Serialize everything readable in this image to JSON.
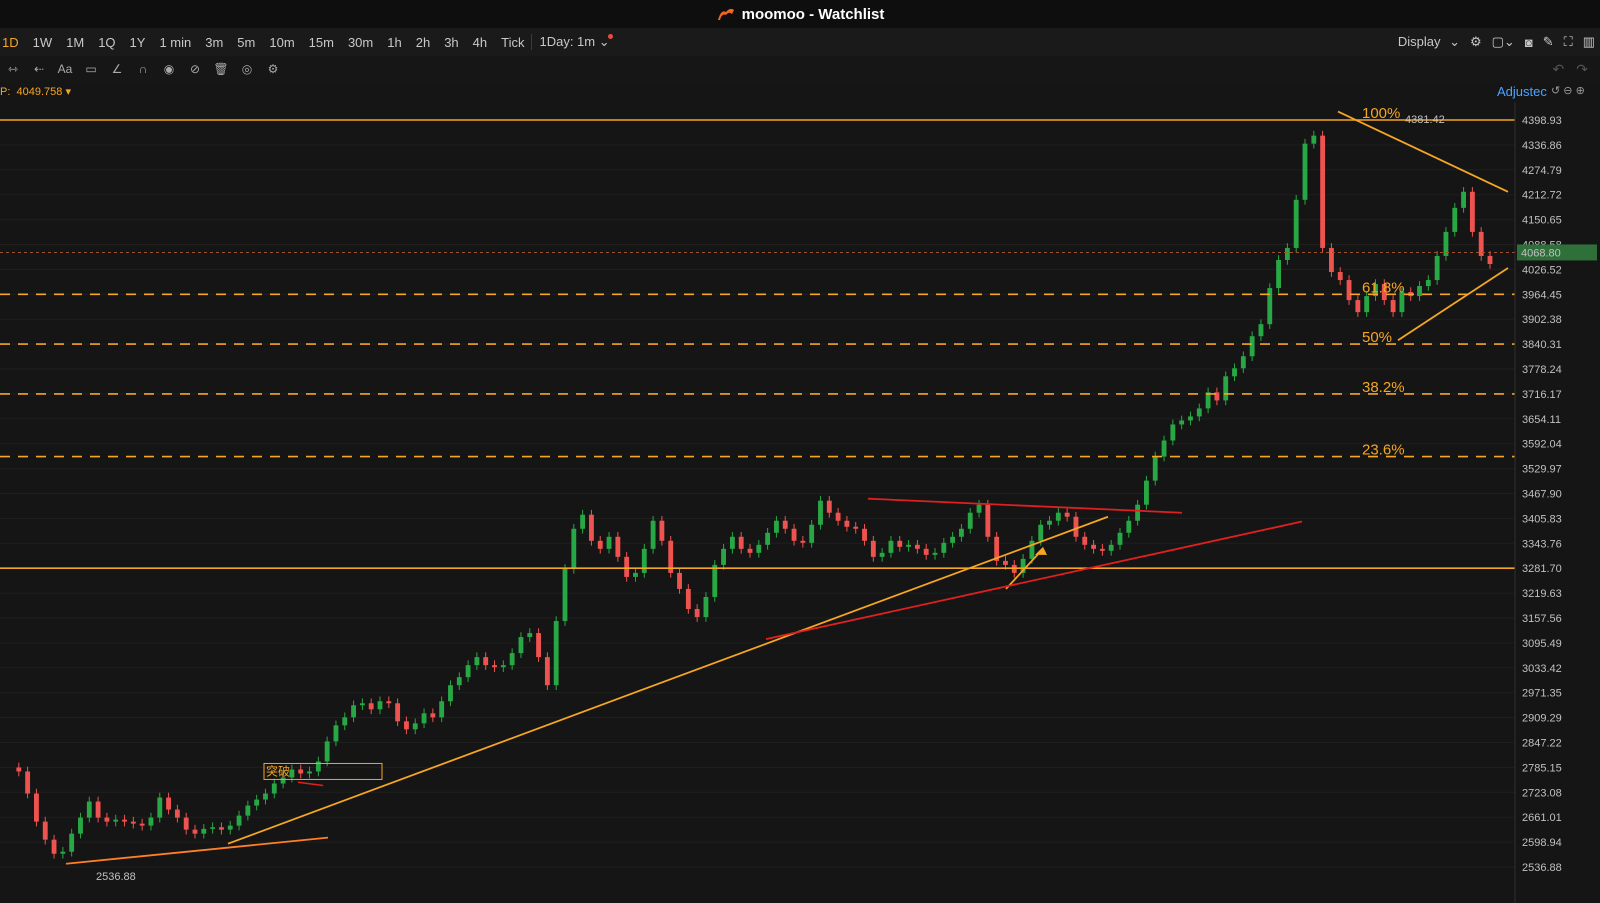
{
  "app": {
    "title": "moomoo - Watchlist"
  },
  "toolbar": {
    "timeframes": [
      "1D",
      "1W",
      "1M",
      "1Q",
      "1Y",
      "1 min",
      "3m",
      "5m",
      "10m",
      "15m",
      "30m",
      "1h",
      "2h",
      "3h",
      "4h",
      "Tick"
    ],
    "active": "1D",
    "interval_label": "1Day: 1m",
    "display_label": "Display"
  },
  "info": {
    "price_prefix": "P:",
    "price": "4049.758",
    "adjusted_label": "Adjustec"
  },
  "chart_data": {
    "type": "candlestick",
    "y_axis_ticks": [
      "4398.93",
      "4336.86",
      "4274.79",
      "4212.72",
      "4150.65",
      "4088.58",
      "4026.52",
      "3964.45",
      "3902.38",
      "3840.31",
      "3778.24",
      "3716.17",
      "3654.11",
      "3592.04",
      "3529.97",
      "3467.90",
      "3405.83",
      "3343.76",
      "3281.70",
      "3219.63",
      "3157.56",
      "3095.49",
      "3033.42",
      "2971.35",
      "2909.29",
      "2847.22",
      "2785.15",
      "2723.08",
      "2661.01",
      "2598.94",
      "2536.88"
    ],
    "ylim": [
      2536.88,
      4398.93
    ],
    "current_price_label": "4068.80",
    "high_label": "4381.42",
    "low_label": "2536.88",
    "fib_levels": [
      {
        "label": "100%",
        "value": 4398.93
      },
      {
        "label": "61.8%",
        "value": 3964.45
      },
      {
        "label": "50%",
        "value": 3840.31
      },
      {
        "label": "38.2%",
        "value": 3716.17
      },
      {
        "label": "23.6%",
        "value": 3560
      }
    ],
    "support_level": 3281.7,
    "annotation": "突破",
    "colors": {
      "up": "#28a745",
      "down": "#ef5350",
      "fib": "#f5a623",
      "trend_red": "#e02020"
    },
    "series": [
      2785,
      2775,
      2720,
      2650,
      2605,
      2570,
      2575,
      2620,
      2660,
      2700,
      2660,
      2650,
      2655,
      2650,
      2645,
      2640,
      2660,
      2710,
      2680,
      2660,
      2630,
      2620,
      2632,
      2636,
      2630,
      2640,
      2665,
      2690,
      2705,
      2720,
      2745,
      2760,
      2780,
      2770,
      2775,
      2800,
      2850,
      2890,
      2910,
      2940,
      2945,
      2930,
      2950,
      2945,
      2900,
      2880,
      2895,
      2920,
      2910,
      2950,
      2990,
      3010,
      3040,
      3060,
      3040,
      3035,
      3040,
      3070,
      3110,
      3120,
      3060,
      2990,
      3150,
      3280,
      3380,
      3415,
      3350,
      3330,
      3360,
      3310,
      3260,
      3270,
      3330,
      3400,
      3350,
      3270,
      3230,
      3180,
      3160,
      3210,
      3290,
      3330,
      3360,
      3330,
      3320,
      3340,
      3370,
      3400,
      3380,
      3350,
      3345,
      3390,
      3450,
      3420,
      3400,
      3385,
      3380,
      3350,
      3310,
      3320,
      3350,
      3335,
      3340,
      3330,
      3315,
      3320,
      3345,
      3360,
      3380,
      3420,
      3440,
      3360,
      3300,
      3290,
      3270,
      3305,
      3350,
      3390,
      3400,
      3420,
      3410,
      3360,
      3340,
      3330,
      3325,
      3340,
      3370,
      3400,
      3440,
      3500,
      3560,
      3600,
      3640,
      3650,
      3660,
      3680,
      3720,
      3700,
      3760,
      3780,
      3810,
      3860,
      3890,
      3980,
      4050,
      4080,
      4200,
      4340,
      4360,
      4080,
      4020,
      4000,
      3950,
      3920,
      3960,
      3990,
      3950,
      3920,
      3970,
      3960,
      3985,
      4000,
      4060,
      4120,
      4180,
      4220,
      4120,
      4060,
      4040
    ]
  }
}
